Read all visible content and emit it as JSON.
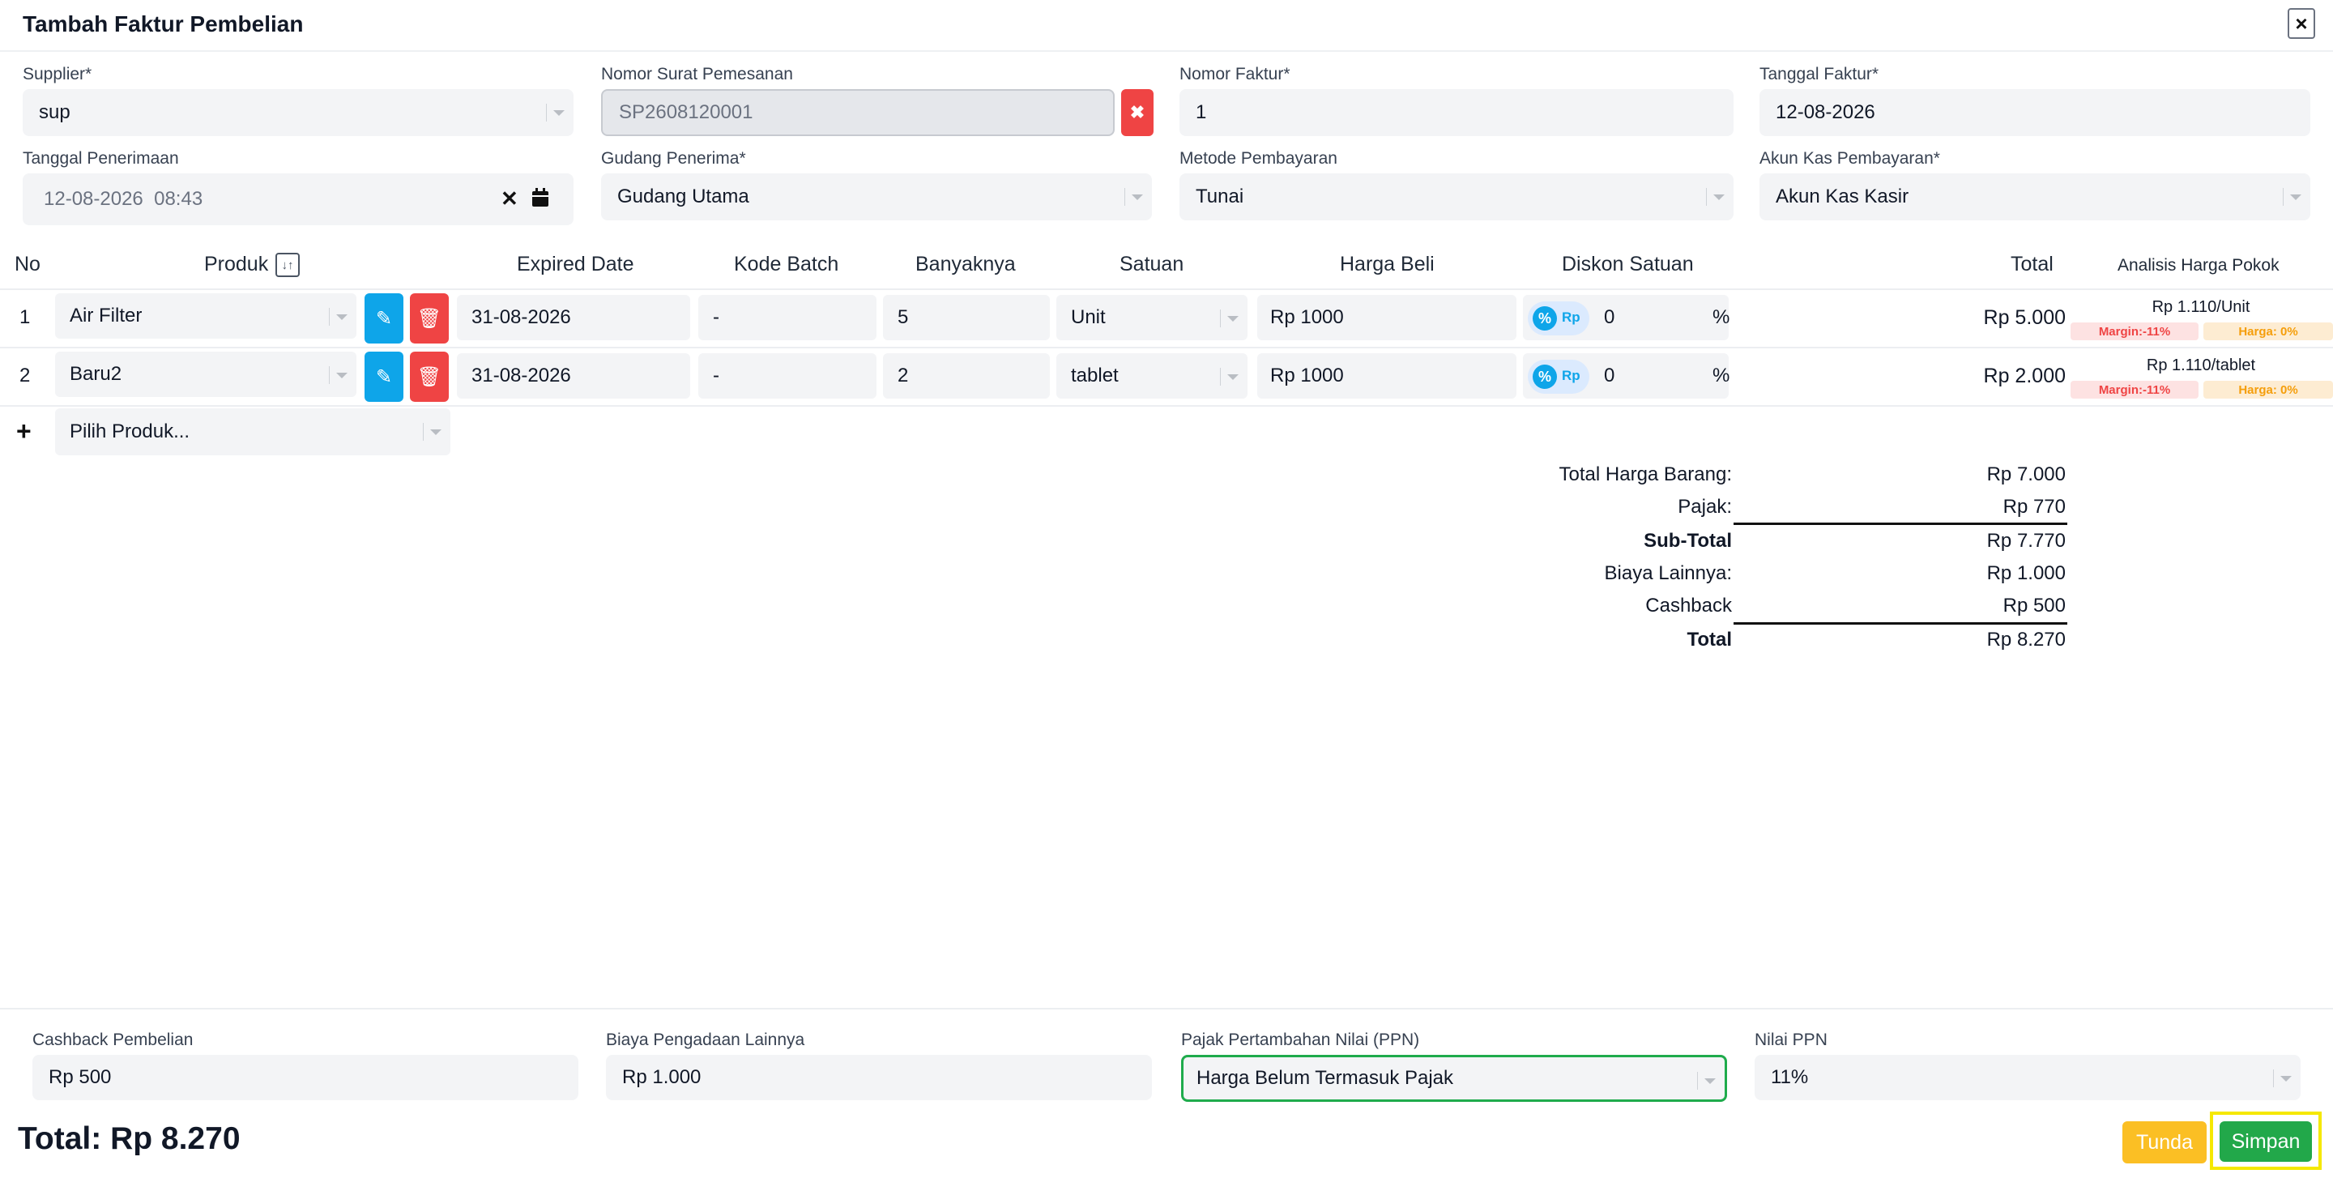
{
  "modal": {
    "title": "Tambah Faktur Pembelian",
    "close_icon": "close-icon"
  },
  "form": {
    "supplier": {
      "label": "Supplier*",
      "value": "sup"
    },
    "nomor_sp": {
      "label": "Nomor Surat Pemesanan",
      "value": "SP2608120001"
    },
    "nomor_faktur": {
      "label": "Nomor Faktur*",
      "value": "1"
    },
    "tanggal_faktur": {
      "label": "Tanggal Faktur*",
      "value": "12-08-2026"
    },
    "tanggal_penerimaan": {
      "label": "Tanggal Penerimaan",
      "value": "12-08-2026  08:43"
    },
    "gudang": {
      "label": "Gudang Penerima*",
      "value": "Gudang Utama"
    },
    "metode": {
      "label": "Metode Pembayaran",
      "value": "Tunai"
    },
    "akun_kas": {
      "label": "Akun Kas Pembayaran*",
      "value": "Akun Kas Kasir"
    }
  },
  "table": {
    "headers": {
      "no": "No",
      "produk": "Produk",
      "expired": "Expired Date",
      "batch": "Kode Batch",
      "qty": "Banyaknya",
      "satuan": "Satuan",
      "harga": "Harga Beli",
      "diskon": "Diskon Satuan",
      "total": "Total",
      "ahp": "Analisis Harga Pokok"
    },
    "rows": [
      {
        "no": "1",
        "produk": "Air Filter",
        "expired": "31-08-2026",
        "batch": "-",
        "qty": "5",
        "satuan": "Unit",
        "harga": "Rp 1000",
        "diskon": "0",
        "total": "Rp 5.000",
        "ahp_price": "Rp 1.110/Unit",
        "margin": "Margin:-11%",
        "harga_badge": "Harga: 0%"
      },
      {
        "no": "2",
        "produk": "Baru2",
        "expired": "31-08-2026",
        "batch": "-",
        "qty": "2",
        "satuan": "tablet",
        "harga": "Rp 1000",
        "diskon": "0",
        "total": "Rp 2.000",
        "ahp_price": "Rp 1.110/tablet",
        "margin": "Margin:-11%",
        "harga_badge": "Harga: 0%"
      }
    ],
    "add_row": {
      "plus": "+",
      "placeholder": "Pilih Produk..."
    },
    "pct_symbol": "%",
    "rp_toggle": "Rp",
    "pct_knob": "%"
  },
  "summary": {
    "total_harga_barang": {
      "label": "Total Harga Barang:",
      "value": "Rp 7.000"
    },
    "pajak": {
      "label": "Pajak:",
      "value": "Rp 770"
    },
    "sub_total": {
      "label": "Sub-Total",
      "value": "Rp 7.770"
    },
    "biaya_lainnya": {
      "label": "Biaya Lainnya:",
      "value": "Rp 1.000"
    },
    "cashback": {
      "label": "Cashback",
      "value": "Rp 500"
    },
    "total": {
      "label": "Total",
      "value": "Rp 8.270"
    }
  },
  "footer": {
    "cashback": {
      "label": "Cashback Pembelian",
      "value": "Rp 500"
    },
    "biaya": {
      "label": "Biaya Pengadaan Lainnya",
      "value": "Rp 1.000"
    },
    "ppn": {
      "label": "Pajak Pertambahan Nilai (PPN)",
      "value": "Harga Belum Termasuk Pajak"
    },
    "nilai_ppn": {
      "label": "Nilai PPN",
      "value": "11%"
    },
    "grand_total": "Total: Rp 8.270",
    "tunda": "Tunda",
    "simpan": "Simpan"
  },
  "colors": {
    "primary": "#0ea5e9",
    "danger": "#ef4444",
    "success": "#22a84a",
    "warning": "#fbbf24",
    "highlight": "#f5e800"
  }
}
